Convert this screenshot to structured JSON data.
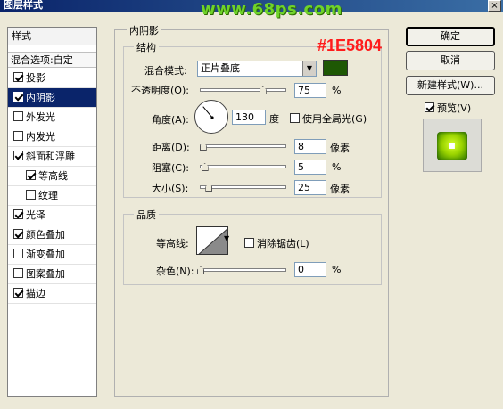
{
  "window": {
    "title": "图层样式",
    "close_glyph": "×"
  },
  "watermark": "www.68ps.com",
  "annotation": "#1E5804",
  "styles_panel": {
    "header": "样式",
    "blend_options": "混合选项:自定",
    "items": [
      {
        "label": "投影",
        "checked": true,
        "selected": false,
        "sub": false
      },
      {
        "label": "内阴影",
        "checked": true,
        "selected": true,
        "sub": false
      },
      {
        "label": "外发光",
        "checked": false,
        "selected": false,
        "sub": false
      },
      {
        "label": "内发光",
        "checked": false,
        "selected": false,
        "sub": false
      },
      {
        "label": "斜面和浮雕",
        "checked": true,
        "selected": false,
        "sub": false
      },
      {
        "label": "等高线",
        "checked": true,
        "selected": false,
        "sub": true
      },
      {
        "label": "纹理",
        "checked": false,
        "selected": false,
        "sub": true
      },
      {
        "label": "光泽",
        "checked": true,
        "selected": false,
        "sub": false
      },
      {
        "label": "颜色叠加",
        "checked": true,
        "selected": false,
        "sub": false
      },
      {
        "label": "渐变叠加",
        "checked": false,
        "selected": false,
        "sub": false
      },
      {
        "label": "图案叠加",
        "checked": false,
        "selected": false,
        "sub": false
      },
      {
        "label": "描边",
        "checked": true,
        "selected": false,
        "sub": false
      }
    ]
  },
  "inner_shadow": {
    "section_title": "内阴影",
    "structure": {
      "title": "结构",
      "blend_mode": {
        "label": "混合模式:",
        "value": "正片叠底",
        "color": "#1E5804"
      },
      "opacity": {
        "label": "不透明度(O):",
        "value": "75",
        "unit": "%",
        "fraction": 0.75
      },
      "angle": {
        "label": "角度(A):",
        "value": "130",
        "unit": "度",
        "degrees": 130,
        "global_light": {
          "label": "使用全局光(G)",
          "checked": false
        }
      },
      "distance": {
        "label": "距离(D):",
        "value": "8",
        "unit": "像素",
        "fraction": 0.03
      },
      "choke": {
        "label": "阻塞(C):",
        "value": "5",
        "unit": "%",
        "fraction": 0.05
      },
      "size": {
        "label": "大小(S):",
        "value": "25",
        "unit": "像素",
        "fraction": 0.1
      }
    },
    "quality": {
      "title": "品质",
      "contour": {
        "label": "等高线:"
      },
      "anti_alias": {
        "label": "消除锯齿(L)",
        "checked": false
      },
      "noise": {
        "label": "杂色(N):",
        "value": "0",
        "unit": "%",
        "fraction": 0.0
      }
    }
  },
  "buttons": {
    "ok": "确定",
    "cancel": "取消",
    "new_style": "新建样式(W)...",
    "preview": {
      "label": "预览(V)",
      "checked": true
    }
  }
}
